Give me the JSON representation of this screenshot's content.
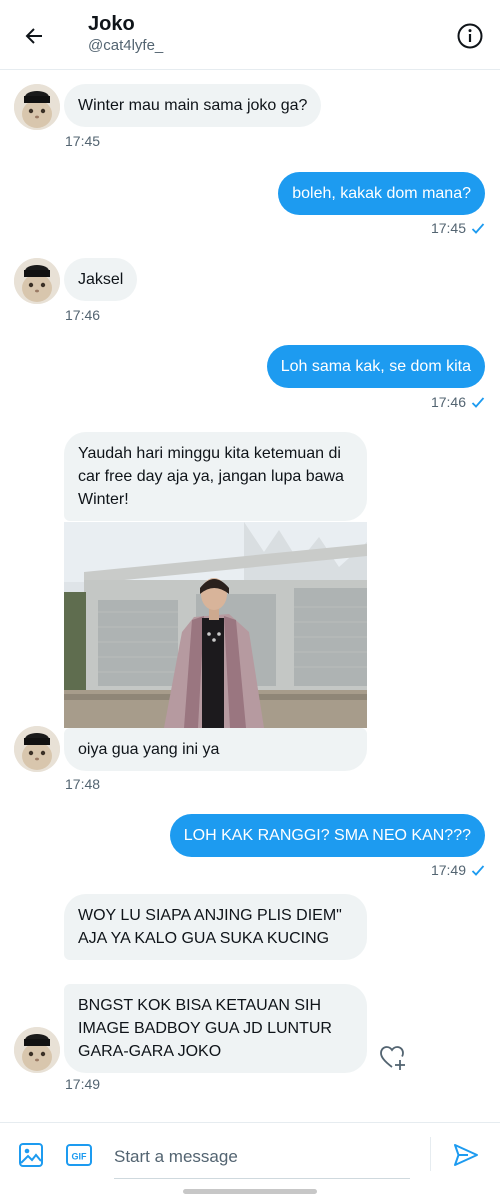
{
  "header": {
    "title": "Joko",
    "handle": "@cat4lyfe_"
  },
  "messages": [
    {
      "sender": "them",
      "text": "Winter mau main sama joko ga?",
      "time": "17:45"
    },
    {
      "sender": "me",
      "text": "boleh, kakak dom mana?",
      "time": "17:45",
      "status": "sent"
    },
    {
      "sender": "them",
      "text": "Jaksel",
      "time": "17:46"
    },
    {
      "sender": "me",
      "text": "Loh sama kak, se dom kita",
      "time": "17:46",
      "status": "sent"
    },
    {
      "sender": "them",
      "text": "Yaudah hari minggu kita ketemuan di car free day aja ya, jangan lupa bawa Winter!"
    },
    {
      "sender": "them",
      "type": "image"
    },
    {
      "sender": "them",
      "text": "oiya gua yang ini ya",
      "time": "17:48"
    },
    {
      "sender": "me",
      "text": "LOH KAK RANGGI? SMA NEO KAN???",
      "time": "17:49",
      "status": "sent"
    },
    {
      "sender": "them",
      "text": "WOY LU SIAPA ANJING PLIS DIEM\" AJA YA KALO GUA SUKA KUCING"
    },
    {
      "sender": "them",
      "text": "BNGST KOK BISA KETAUAN SIH IMAGE BADBOY GUA JD LUNTUR GARA-GARA JOKO",
      "time": "17:49"
    }
  ],
  "composer": {
    "placeholder": "Start a message"
  },
  "colors": {
    "accent": "#1d9bf0",
    "incoming_bubble": "#eff3f4",
    "secondary_text": "#536471"
  },
  "icons": {
    "back": "arrow-left-icon",
    "info": "info-icon",
    "image": "image-icon",
    "gif": "gif-icon",
    "send": "send-icon",
    "react": "heart-plus-icon",
    "read": "check-icon"
  }
}
